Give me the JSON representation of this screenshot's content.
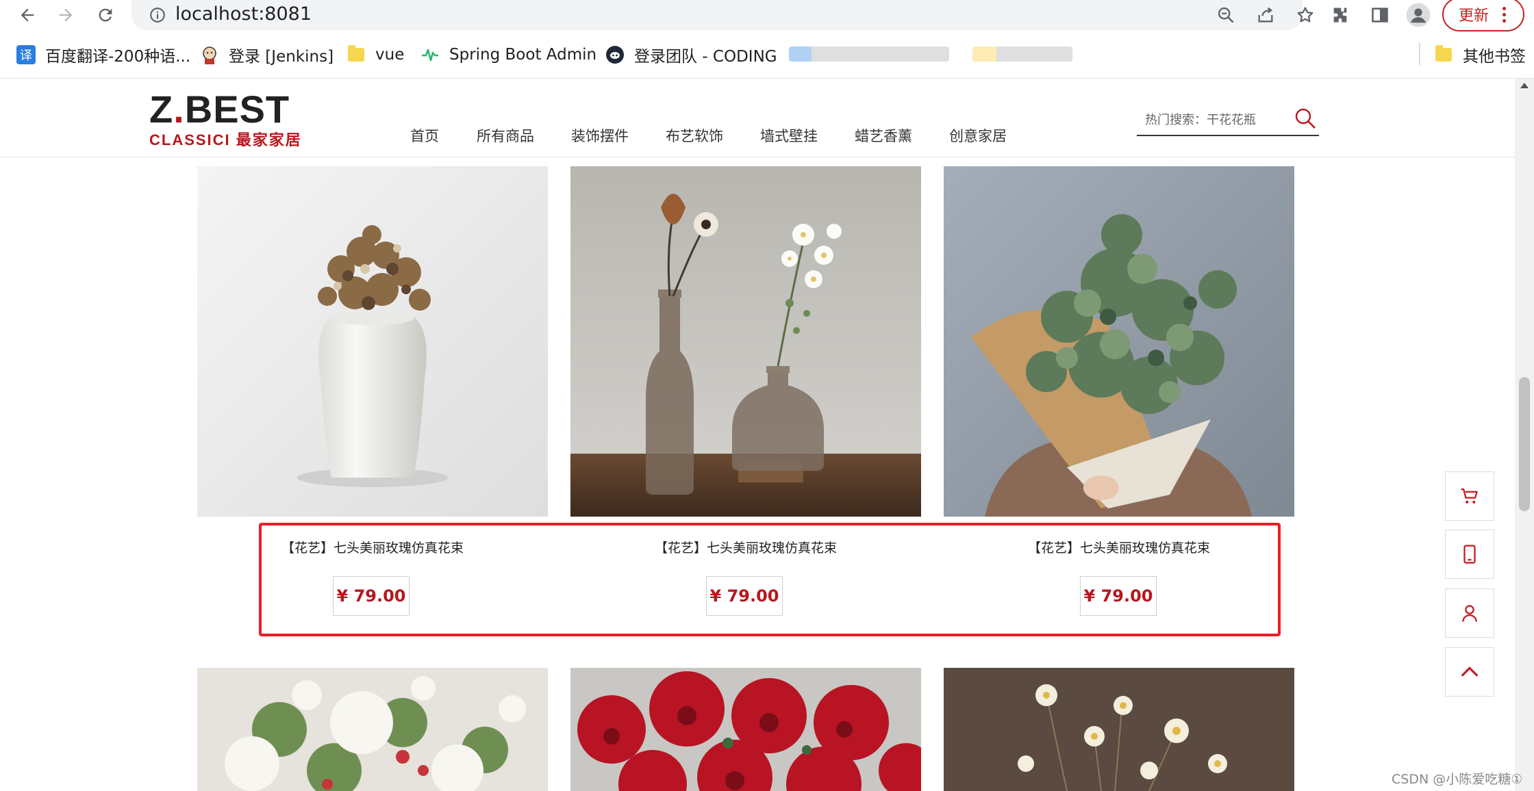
{
  "browser": {
    "url": "localhost:8081",
    "update_label": "更新",
    "bookmarks": [
      {
        "label": "百度翻译-200种语...",
        "icon": "baidu-translate-icon"
      },
      {
        "label": "登录 [Jenkins]",
        "icon": "jenkins-icon"
      },
      {
        "label": "vue",
        "icon": "folder-icon"
      },
      {
        "label": "Spring Boot Admin",
        "icon": "spring-boot-admin-icon"
      },
      {
        "label": "登录团队 - CODING",
        "icon": "coding-icon"
      }
    ],
    "other_bookmarks": "其他书签"
  },
  "site": {
    "logo": {
      "main_dark": "Z",
      "main_red": ".",
      "main_rest": "BEST",
      "sub": "CLASSICI 最家家居"
    },
    "nav": [
      "首页",
      "所有商品",
      "装饰摆件",
      "布艺软饰",
      "墙式壁挂",
      "蜡艺香薰",
      "创意家居"
    ],
    "search_placeholder": "热门搜索：干花花瓶",
    "accent_color": "#b8161e"
  },
  "products": [
    {
      "title": "【花艺】七头美丽玫瑰仿真花束",
      "price": "¥ 79.00",
      "image": "dried-flowers-white-vase"
    },
    {
      "title": "【花艺】七头美丽玫瑰仿真花束",
      "price": "¥ 79.00",
      "image": "flowers-glass-bottles"
    },
    {
      "title": "【花艺】七头美丽玫瑰仿真花束",
      "price": "¥ 79.00",
      "image": "eucalyptus-bouquet"
    }
  ],
  "products_row2": [
    {
      "image": "white-peony-bouquet"
    },
    {
      "image": "red-carnations"
    },
    {
      "image": "white-daisies"
    }
  ],
  "sidebar_tools": [
    "cart-icon",
    "mobile-icon",
    "user-icon",
    "back-to-top-icon"
  ],
  "watermark": "CSDN @小陈爱吃糖①"
}
